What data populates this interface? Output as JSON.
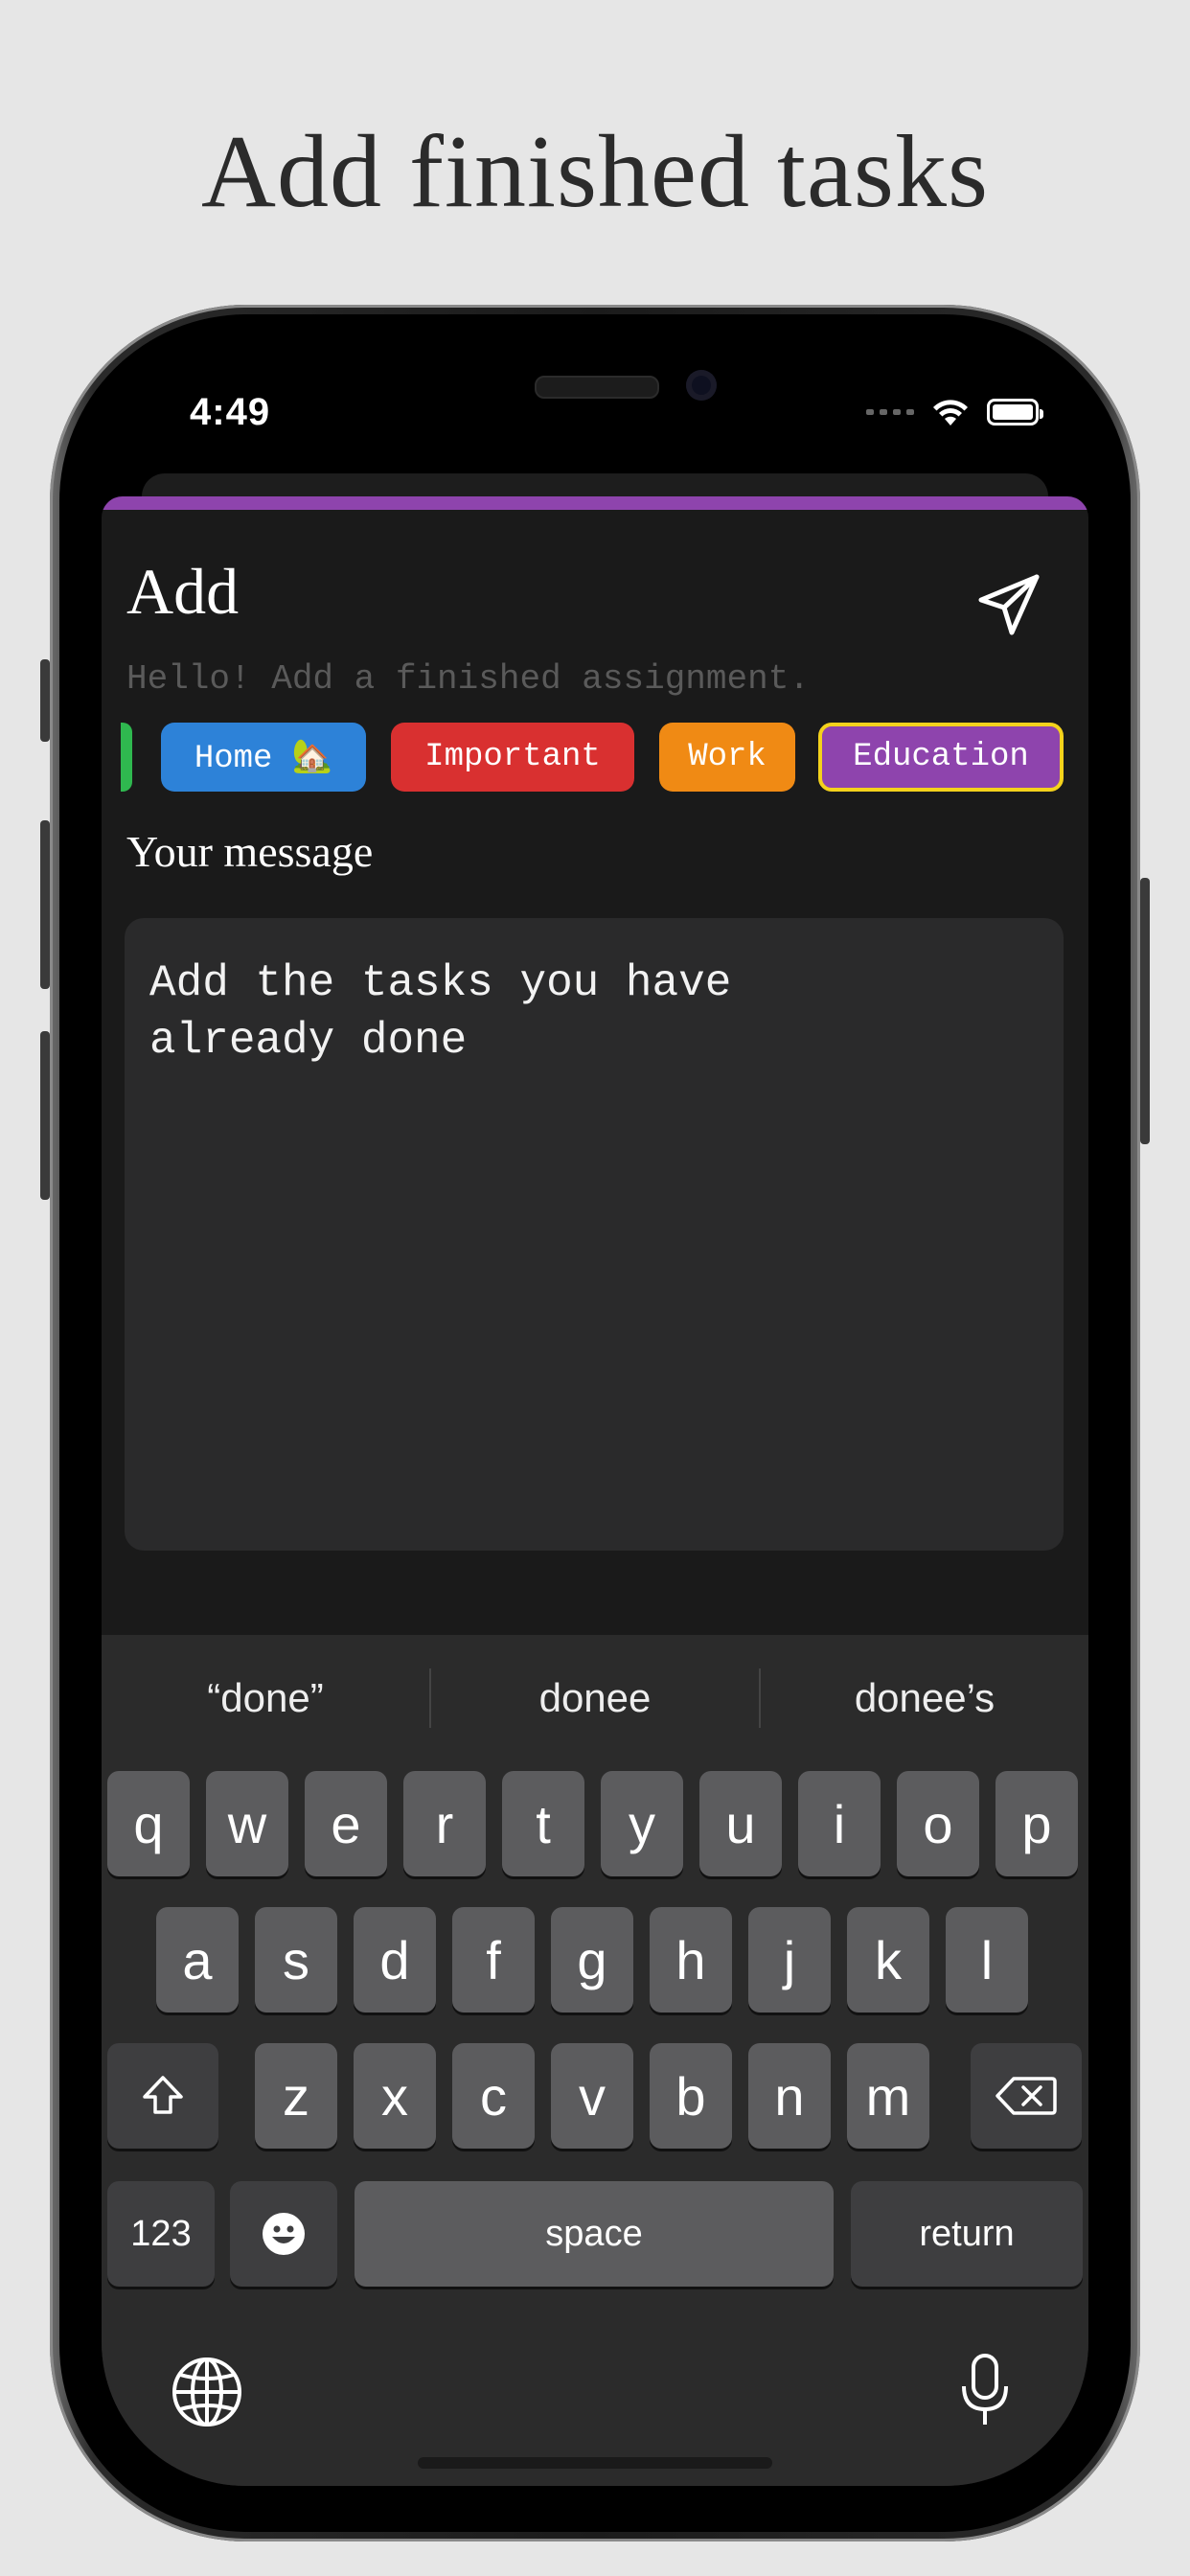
{
  "headline": "Add finished tasks",
  "status_bar": {
    "time": "4:49"
  },
  "sheet": {
    "title": "Add",
    "subtitle": "Hello! Add a finished assignment.",
    "section_label": "Your message",
    "message": "Add the tasks you have\nalready done"
  },
  "categories": [
    {
      "label": "",
      "color": "#2fb84f"
    },
    {
      "label": "Home 🏡",
      "color": "#2d82d8"
    },
    {
      "label": "Important",
      "color": "#d93030"
    },
    {
      "label": "Work",
      "color": "#f08a14"
    },
    {
      "label": "Education",
      "color": "#8e44ad",
      "selected": true,
      "border_color": "#f4d21c"
    }
  ],
  "keyboard": {
    "suggestions": [
      "“done”",
      "donee",
      "donee’s"
    ],
    "row1": [
      "q",
      "w",
      "e",
      "r",
      "t",
      "y",
      "u",
      "i",
      "o",
      "p"
    ],
    "row2": [
      "a",
      "s",
      "d",
      "f",
      "g",
      "h",
      "j",
      "k",
      "l"
    ],
    "row3": [
      "z",
      "x",
      "c",
      "v",
      "b",
      "n",
      "m"
    ],
    "numbers_label": "123",
    "space_label": "space",
    "return_label": "return"
  },
  "colors": {
    "accent": "#8e44ad",
    "background": "#1a1a1a",
    "field": "#2a2a2b"
  }
}
